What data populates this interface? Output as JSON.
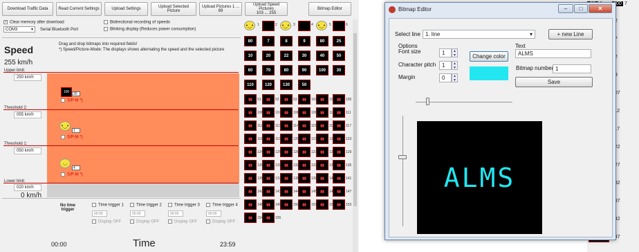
{
  "toolbar": {
    "download": "Download Traffic Data",
    "read": "Read Current Settings",
    "upload_settings": "Upload Settings",
    "upload_selected": "Upload Selected Picture",
    "upload_pictures": "Upload Pictures 1 ... 89",
    "upload_speed_1": "Upload Speed Pictures",
    "upload_speed_2": "103 ... 255",
    "bitmap_editor": "Bitmap Editor"
  },
  "options": {
    "clear_memory": "Clear memory after download",
    "com_port": "COM3",
    "serial": "Serial Bluetooth Port",
    "bidirectional": "Bidirectional recording of speeds",
    "blinking": "Blinking display (Reduces power consumption)",
    "drag_hint_1": "Drag and drop bitmaps into required fields!",
    "drag_hint_2": "*) Speed/Picture-Mode: The displays shows alternating the speed and the selected picture"
  },
  "speed": {
    "title": "Speed",
    "max": "255 km/h",
    "upper_label": "Upper limit:",
    "upper_value": "250  km/h",
    "t2_label": "Threshold 2:",
    "t2_value": "055  km/h",
    "t1_label": "Threshold 1:",
    "t1_value": "050  km/h",
    "lower_label": "Lower limit:",
    "lower_value": "020  km/h",
    "min": "0  km/h",
    "band1_sign": "100",
    "band1_num": "30",
    "band2_num": "1",
    "band3_num": "4",
    "spm": "S/P-M *)"
  },
  "time": {
    "no_trigger_1": "No time",
    "no_trigger_2": "trigger",
    "triggers": [
      "Time trigger 1",
      "Time trigger 2",
      "Time trigger 3",
      "Time trigger 4"
    ],
    "trigger_time": "00:00",
    "display_off": "Display OFF",
    "start": "00:00",
    "title": "Time",
    "end": "23:59"
  },
  "grid": {
    "top_num": [
      "1",
      "2",
      "3",
      "4",
      "5",
      "6"
    ],
    "speed_rows": [
      [
        "80",
        "7",
        "8",
        "9",
        "80",
        "25"
      ],
      [
        "10",
        "20",
        "22",
        "30",
        "40",
        "50"
      ],
      [
        "60",
        "70",
        "80",
        "90",
        "100",
        "30"
      ],
      [
        "110",
        "120",
        "130",
        "50"
      ]
    ],
    "row_nums": [
      "51",
      "52",
      "53",
      "103",
      "104",
      "105",
      "106",
      "107",
      "108",
      "109",
      "110",
      "111",
      "112",
      "113",
      "114",
      "115",
      "116",
      "117",
      "118",
      "119",
      "120",
      "121",
      "122",
      "123",
      "124",
      "125",
      "126",
      "127",
      "128",
      "129",
      "130",
      "131",
      "132",
      "133",
      "134",
      "135",
      "136",
      "137",
      "138",
      "139",
      "140",
      "141",
      "142",
      "143",
      "144",
      "145",
      "146",
      "147",
      "148",
      "149",
      "150",
      "151",
      "152",
      "153",
      "154",
      "155"
    ],
    "side_nums": [
      "22",
      "27",
      "32",
      "53",
      "107",
      "112",
      "117",
      "122",
      "127",
      "132",
      "137",
      "142",
      "147"
    ],
    "side_top": [
      "80",
      "6",
      "100",
      "7"
    ]
  },
  "dialog": {
    "title": "Bitmap Editor",
    "select_line_label": "Select line",
    "select_line_value": "1. line",
    "new_line": "+ new Line",
    "options_label": "Options",
    "font_size_label": "Font size",
    "font_size": "1",
    "pitch_label": "Character pitch",
    "pitch": "1",
    "margin_label": "Margin",
    "margin": "0",
    "change_color": "Change color",
    "color": "#22e6f0",
    "text_label": "Text",
    "text_value": "ALMS",
    "bitmap_number_label": "Bitmap number",
    "bitmap_number": "1",
    "save": "Save",
    "preview_text": "ALMS"
  }
}
